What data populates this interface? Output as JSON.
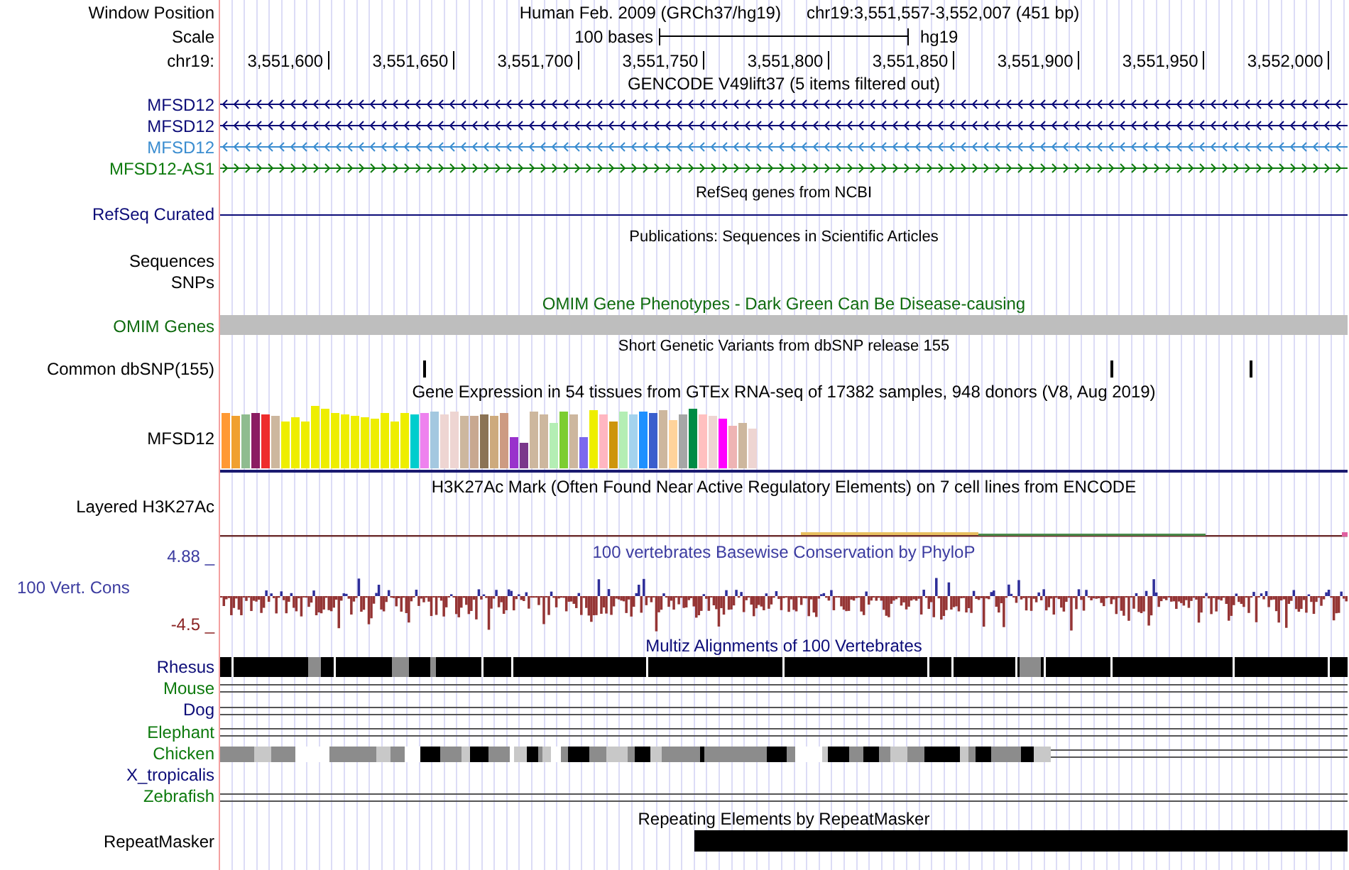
{
  "header": {
    "window_position_label": "Window Position",
    "assembly": "Human Feb. 2009 (GRCh37/hg19)",
    "position": "chr19:3,551,557-3,552,007 (451 bp)",
    "scale_label": "Scale",
    "scale_text": "100 bases",
    "scale_assembly": "hg19",
    "chrom_label": "chr19:",
    "ticks": [
      "3,551,600",
      "3,551,650",
      "3,551,700",
      "3,551,750",
      "3,551,800",
      "3,551,850",
      "3,551,900",
      "3,551,950",
      "3,552,000"
    ]
  },
  "tracks": [
    {
      "kind": "genes",
      "title": "GENCODE V49lift37 (5 items filtered out)",
      "items": [
        {
          "name": "MFSD12",
          "reverse": true,
          "color": "#0c0c78"
        },
        {
          "name": "MFSD12",
          "reverse": true,
          "color": "#0c0c78"
        },
        {
          "name": "MFSD12",
          "reverse": true,
          "color": "#3b8dd0"
        },
        {
          "name": "MFSD12-AS1",
          "reverse": false,
          "color": "#0d7a0d"
        }
      ]
    },
    {
      "kind": "refseq",
      "title": "RefSeq genes from NCBI",
      "labels": [
        "RefSeq Curated"
      ]
    },
    {
      "kind": "empty",
      "title": "Publications: Sequences in Scientific Articles",
      "labels": [
        "Sequences",
        "SNPs"
      ]
    },
    {
      "kind": "omim",
      "title": "OMIM Gene Phenotypes - Dark Green Can Be Disease-causing",
      "labels": [
        "OMIM Genes"
      ]
    },
    {
      "kind": "snp",
      "title": "Short Genetic Variants from dbSNP release 155",
      "labels": [
        "Common dbSNP(155)"
      ]
    },
    {
      "kind": "gtex",
      "title": "Gene Expression in 54 tissues from GTEx RNA-seq of 17382 samples, 948 donors (V8, Aug 2019)",
      "labels": [
        "MFSD12"
      ]
    },
    {
      "kind": "h3k27ac",
      "title": "H3K27Ac Mark (Often Found Near Active Regulatory Elements) on 7 cell lines from ENCODE",
      "labels": [
        "Layered H3K27Ac"
      ]
    },
    {
      "kind": "phylop",
      "title": "100 vertebrates Basewise Conservation by PhyloP",
      "labels": [
        "4.88 _",
        "100 Vert. Cons",
        "-4.5 _"
      ]
    },
    {
      "kind": "multiz",
      "title": "Multiz Alignments of 100 Vertebrates",
      "species": [
        {
          "name": "Rhesus",
          "kind": "blocks",
          "color": "#0c0c78"
        },
        {
          "name": "Mouse",
          "kind": "lines",
          "color": "#0d7a0d"
        },
        {
          "name": "Dog",
          "kind": "lines",
          "color": "#0c0c78"
        },
        {
          "name": "Elephant",
          "kind": "lines",
          "color": "#0d7a0d"
        },
        {
          "name": "Chicken",
          "kind": "mixed",
          "color": "#0d7a0d"
        },
        {
          "name": "X_tropicalis",
          "kind": "none",
          "color": "#0c0c78"
        },
        {
          "name": "Zebrafish",
          "kind": "lines",
          "color": "#0d7a0d"
        }
      ]
    },
    {
      "kind": "repeat",
      "title": "Repeating Elements by RepeatMasker",
      "labels": [
        "RepeatMasker"
      ]
    }
  ]
}
